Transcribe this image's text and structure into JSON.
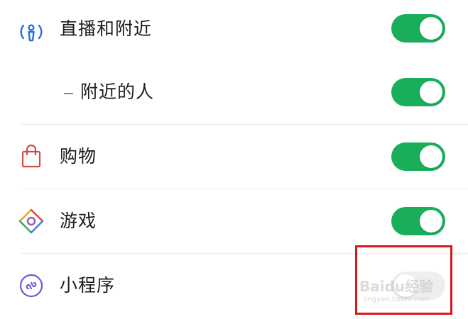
{
  "settings_list": {
    "items": [
      {
        "label": "直播和附近",
        "icon": "live-nearby-icon",
        "toggle_on": true,
        "indented": false
      },
      {
        "label": "附近的人",
        "icon": null,
        "toggle_on": true,
        "indented": true
      },
      {
        "label": "购物",
        "icon": "shopping-bag-icon",
        "toggle_on": true,
        "indented": false
      },
      {
        "label": "游戏",
        "icon": "game-icon",
        "toggle_on": true,
        "indented": false
      },
      {
        "label": "小程序",
        "icon": "mini-program-icon",
        "toggle_on": false,
        "indented": false
      }
    ]
  },
  "watermark": {
    "brand": "Baidu经验",
    "url": "jingyan.baidu.com"
  },
  "colors": {
    "toggle_on": "#1aad5a",
    "toggle_off": "#eeeeee",
    "highlight": "#d9161d",
    "divider": "#ececec"
  }
}
